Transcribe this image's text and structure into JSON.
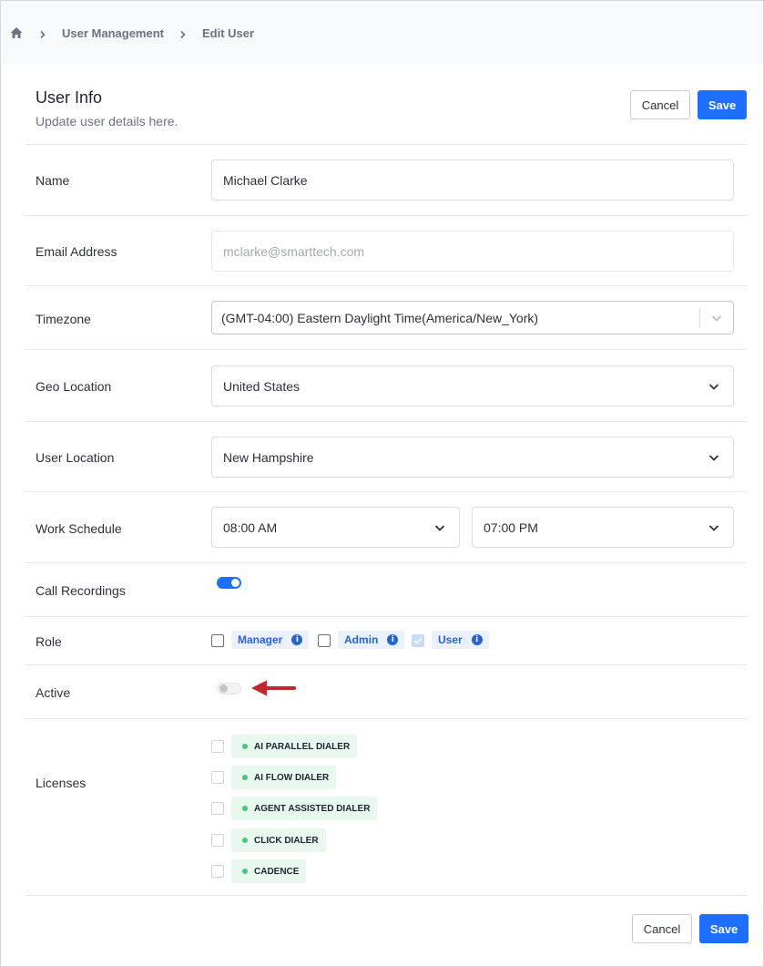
{
  "breadcrumb": {
    "items": [
      "User Management",
      "Edit User"
    ]
  },
  "header": {
    "title": "User Info",
    "subtitle": "Update user details here.",
    "cancel_label": "Cancel",
    "save_label": "Save"
  },
  "form": {
    "name": {
      "label": "Name",
      "value": "Michael Clarke"
    },
    "email": {
      "label": "Email Address",
      "value": "mclarke@smarttech.com"
    },
    "timezone": {
      "label": "Timezone",
      "value": "(GMT-04:00) Eastern Daylight Time(America/New_York)"
    },
    "geo_location": {
      "label": "Geo Location",
      "value": "United States"
    },
    "user_location": {
      "label": "User Location",
      "value": "New Hampshire"
    },
    "work_schedule": {
      "label": "Work Schedule",
      "start": "08:00 AM",
      "end": "07:00 PM"
    },
    "call_recordings": {
      "label": "Call Recordings",
      "enabled": true
    },
    "role": {
      "label": "Role",
      "options": [
        {
          "label": "Manager",
          "checked": false
        },
        {
          "label": "Admin",
          "checked": false
        },
        {
          "label": "User",
          "checked": true,
          "disabled": true
        }
      ]
    },
    "active": {
      "label": "Active",
      "enabled": false
    },
    "licenses": {
      "label": "Licenses",
      "items": [
        "AI PARALLEL DIALER",
        "AI FLOW DIALER",
        "AGENT ASSISTED DIALER",
        "CLICK DIALER",
        "CADENCE"
      ]
    }
  },
  "footer": {
    "cancel_label": "Cancel",
    "save_label": "Save"
  },
  "colors": {
    "accent": "#1f6fff",
    "annotation_arrow": "#c0282d",
    "license_dot": "#48c774"
  }
}
